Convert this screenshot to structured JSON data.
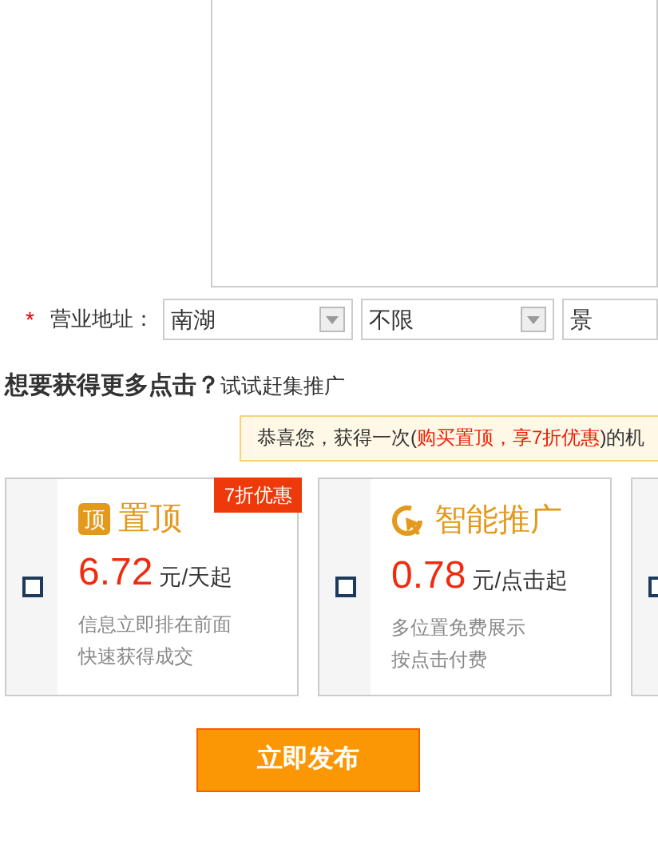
{
  "address": {
    "required_mark": "*",
    "label": "营业地址：",
    "selects": [
      {
        "value": "南湖"
      },
      {
        "value": "不限"
      },
      {
        "value": "景"
      }
    ]
  },
  "promo": {
    "heading": "想要获得更多点击？",
    "subheading": "试试赶集推广",
    "tooltip": {
      "prefix": "恭喜您，获得一次(",
      "highlight": "购买置顶，享7折优惠 ",
      "suffix": ")的机"
    },
    "cards": [
      {
        "kind": "top",
        "checked": false,
        "icon_text": "顶",
        "title": "置顶",
        "price": "6.72",
        "unit": "元/天起",
        "lines": [
          "信息立即排在前面",
          "快速获得成交"
        ],
        "badge": "7折优惠"
      },
      {
        "kind": "smart",
        "checked": false,
        "title": "智能推广",
        "price": "0.78",
        "unit": "元/点击起",
        "lines": [
          "多位置免费展示",
          "按点击付费"
        ]
      },
      {
        "kind": "blank",
        "checked": false
      }
    ]
  },
  "submit": "立即发布"
}
